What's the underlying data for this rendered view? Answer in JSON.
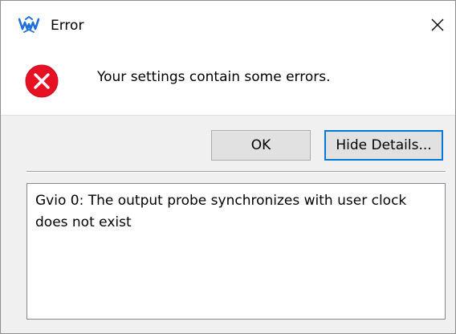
{
  "window": {
    "title": "Error",
    "close_icon": "close-icon",
    "app_icon": "gowin-logo-icon"
  },
  "message": {
    "icon": "error-icon",
    "text": "Your settings contain some errors."
  },
  "buttons": {
    "ok_label": "OK",
    "details_label": "Hide Details..."
  },
  "details": {
    "text": "Gvio 0: The output probe synchronizes with user clock does not exist"
  },
  "colors": {
    "error_red": "#e81123",
    "focus_border": "#0078d7",
    "logo_blue": "#1e6fd9"
  }
}
